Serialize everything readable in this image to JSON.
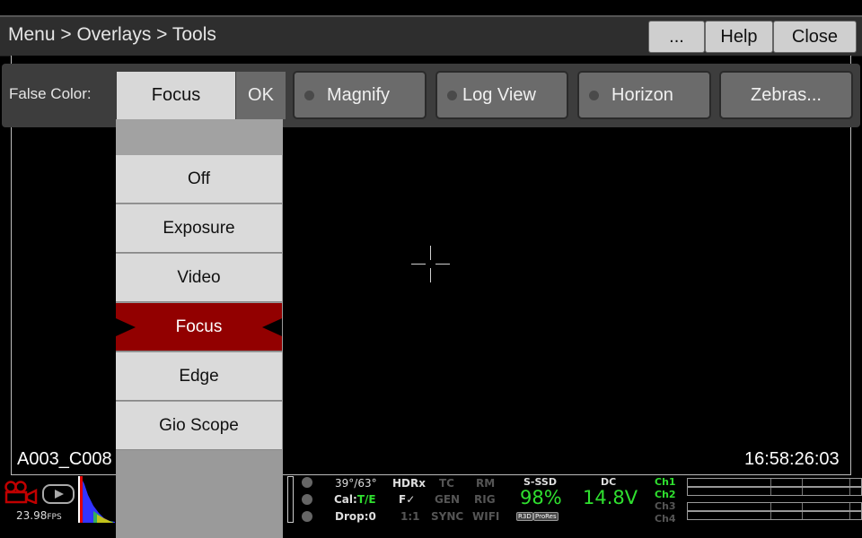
{
  "header": {
    "breadcrumb": "Menu > Overlays > Tools",
    "more_label": "...",
    "help_label": "Help",
    "close_label": "Close"
  },
  "tools": {
    "false_color_label": "False Color:",
    "false_color_value": "Focus",
    "ok_label": "OK",
    "magnify_label": "Magnify",
    "logview_label": "Log View",
    "horizon_label": "Horizon",
    "zebras_label": "Zebras..."
  },
  "dropdown": {
    "options": [
      "Off",
      "Exposure",
      "Video",
      "Focus",
      "Edge",
      "Gio Scope"
    ],
    "selected": "Focus"
  },
  "viewer": {
    "clip_name": "A003_C008",
    "timecode": "16:58:26:03"
  },
  "status": {
    "fps": "23.98",
    "fps_unit": "FPS",
    "temp": "39°/63°",
    "cal_label": "Cal:",
    "cal_value": "T/E",
    "drop": "Drop:0",
    "hdrx": "HDRx",
    "hdrx_value": "F✓",
    "ratio": "1:1",
    "tc": "TC",
    "gen": "GEN",
    "sync": "SYNC",
    "rm": "RM",
    "rig": "RIG",
    "wifi": "WIFI",
    "media_label": "S-SSD",
    "media_value": "98%",
    "badge_r3d": "R3D",
    "badge_prores": "ProRes",
    "power_label": "DC",
    "power_value": "14.8V",
    "channels": [
      "Ch1",
      "Ch2",
      "Ch3",
      "Ch4"
    ]
  },
  "colors": {
    "selected_item": "#920000",
    "status_green": "#2fe02f",
    "record_icon": "#c00000"
  }
}
